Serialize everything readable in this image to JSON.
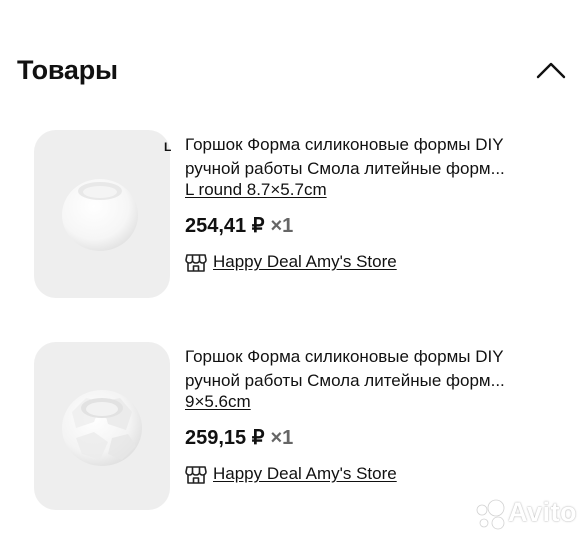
{
  "section": {
    "title": "Товары"
  },
  "products": [
    {
      "corner_mark": "L",
      "title_line1": "Горшок Форма силиконовые формы DIY",
      "title_line2": "ручной работы Смола литейные форм...",
      "variant": "L round 8.7×5.7cm",
      "price": "254,41 ₽",
      "quantity": "×1",
      "store": "Happy Deal Amy's Store"
    },
    {
      "title_line1": "Горшок Форма силиконовые формы DIY",
      "title_line2": "ручной работы Смола литейные форм...",
      "variant": "9×5.6cm",
      "price": "259,15 ₽",
      "quantity": "×1",
      "store": "Happy Deal Amy's Store"
    }
  ],
  "icons": {
    "collapse": "chevron-up-icon",
    "store": "store-icon"
  },
  "watermark": {
    "text": "Avito"
  },
  "colors": {
    "text": "#111111",
    "muted": "#666666",
    "thumb_bg": "#eeeeee"
  }
}
